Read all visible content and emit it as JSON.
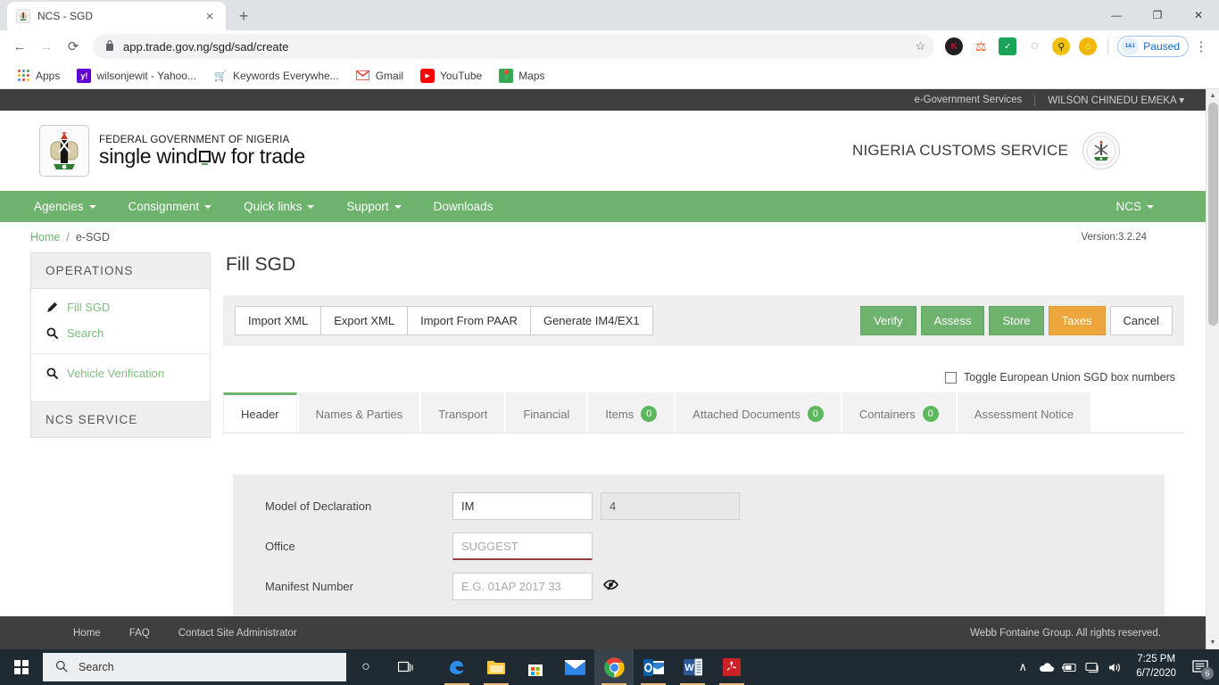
{
  "browser": {
    "tab": {
      "title": "NCS - SGD",
      "favicon": "nigeria-coat-of-arms-icon",
      "close": "×"
    },
    "new_tab_label": "+",
    "window_controls": {
      "minimize": "—",
      "maximize": "❐",
      "close": "✕"
    },
    "nav": {
      "back": "←",
      "forward": "→",
      "reload": "⟳"
    },
    "omnibox": {
      "lock": "🔒",
      "url": "app.trade.gov.ng/sgd/sad/create",
      "star": "☆"
    },
    "extensions": [
      {
        "name": "kaspersky-extension-icon",
        "glyph": "K",
        "color": "#231f20"
      },
      {
        "name": "lighthouse-extension-icon",
        "glyph": "♟",
        "color": "#f4511e"
      },
      {
        "name": "checkmark-extension-icon",
        "glyph": "✔",
        "color": "#18a558"
      },
      {
        "name": "circle-extension-icon",
        "glyph": "◌",
        "color": "#b9bcc0"
      },
      {
        "name": "magnifier-extension-icon",
        "glyph": "🔍",
        "color": "#f2c10e"
      },
      {
        "name": "home-extension-icon",
        "glyph": "⌂",
        "color": "#f2b705"
      }
    ],
    "paused": {
      "label": "Paused",
      "logo_text": "1&1"
    },
    "menu": "⋮",
    "bookmarks": [
      {
        "label": "Apps",
        "icon": "apps-grid-icon"
      },
      {
        "label": "wilsonjewit - Yahoo...",
        "icon": "yahoo-icon",
        "glyph": "y!",
        "color": "#6001d2"
      },
      {
        "label": "Keywords Everywhe...",
        "icon": "keywords-everywhere-icon",
        "glyph": "🛒",
        "color": "#d64545"
      },
      {
        "label": "Gmail",
        "icon": "gmail-icon",
        "glyph": "M",
        "color": "#ea4335"
      },
      {
        "label": "YouTube",
        "icon": "youtube-icon",
        "glyph": "▶",
        "color": "#ff0000"
      },
      {
        "label": "Maps",
        "icon": "google-maps-icon",
        "glyph": "📍",
        "color": "#34a853"
      }
    ]
  },
  "site": {
    "topbar": {
      "egov": "e-Government Services",
      "user": "WILSON CHINEDU EMEKA",
      "caret": "▾"
    },
    "logo": {
      "line1": "FEDERAL GOVERNMENT OF NIGERIA",
      "line2_before": "single wind",
      "line2_after": "w for trade"
    },
    "agency": {
      "title": "NIGERIA CUSTOMS SERVICE"
    },
    "nav": [
      {
        "label": "Agencies",
        "has_caret": true
      },
      {
        "label": "Consignment",
        "has_caret": true
      },
      {
        "label": "Quick links",
        "has_caret": true
      },
      {
        "label": "Support",
        "has_caret": true
      },
      {
        "label": "Downloads",
        "has_caret": false
      }
    ],
    "nav_right": {
      "label": "NCS",
      "has_caret": true
    },
    "breadcrumb": {
      "home": "Home",
      "slash": "/",
      "current": "e-SGD"
    },
    "version": "Version:3.2.24",
    "sidebar": {
      "section1_title": "OPERATIONS",
      "items": [
        {
          "label": "Fill SGD",
          "icon": "pencil-icon",
          "glyph": "✎"
        },
        {
          "label": "Search",
          "icon": "search-icon",
          "glyph": "🔍"
        },
        {
          "label": "Vehicle Verification",
          "icon": "search-icon",
          "glyph": "🔍"
        }
      ],
      "section2_title": "NCS SERVICE"
    },
    "page_title": "Fill SGD",
    "actionbar": {
      "left_buttons": [
        "Import XML",
        "Export XML",
        "Import From PAAR",
        "Generate IM4/EX1"
      ],
      "right_buttons": [
        {
          "label": "Verify",
          "style": "green"
        },
        {
          "label": "Assess",
          "style": "green"
        },
        {
          "label": "Store",
          "style": "green"
        },
        {
          "label": "Taxes",
          "style": "orange"
        },
        {
          "label": "Cancel",
          "style": "white"
        }
      ]
    },
    "toggle_eu": {
      "label": "Toggle European Union SGD box numbers",
      "checked": false
    },
    "tabs": [
      {
        "label": "Header",
        "badge": null,
        "active": true
      },
      {
        "label": "Names & Parties",
        "badge": null,
        "active": false
      },
      {
        "label": "Transport",
        "badge": null,
        "active": false
      },
      {
        "label": "Financial",
        "badge": null,
        "active": false
      },
      {
        "label": "Items",
        "badge": "0",
        "active": false
      },
      {
        "label": "Attached Documents",
        "badge": "0",
        "active": false
      },
      {
        "label": "Containers",
        "badge": "0",
        "active": false
      },
      {
        "label": "Assessment Notice",
        "badge": null,
        "active": false
      }
    ],
    "form": {
      "model_label": "Model of Declaration",
      "model_value": "IM",
      "model_type_value": "4",
      "office_label": "Office",
      "office_placeholder": "SUGGEST",
      "manifest_label": "Manifest Number",
      "manifest_placeholder": "E.G. 01AP 2017 33",
      "manifest_icon": "eye-slash-icon",
      "manifest_icon_glyph": "👁"
    },
    "footer": {
      "links": [
        "Home",
        "FAQ",
        "Contact Site Administrator"
      ],
      "copyright": "Webb Fontaine Group. All rights reserved."
    },
    "scrollbar": {
      "up": "▲",
      "down": "▼"
    }
  },
  "taskbar": {
    "start": "windows-logo-icon",
    "search_placeholder": "Search",
    "search_icon": "magnifier-icon",
    "cortana": "○",
    "taskview": "⌸",
    "apps": [
      {
        "name": "edge-icon",
        "glyph": "e",
        "color": "#0c7cbe"
      },
      {
        "name": "file-explorer-icon",
        "glyph": "🗀",
        "color": "#ffc83d"
      },
      {
        "name": "microsoft-store-icon",
        "glyph": "🛍",
        "color": "#ffffff"
      },
      {
        "name": "mail-icon",
        "glyph": "✉",
        "color": "#0a62c0"
      },
      {
        "name": "chrome-icon",
        "glyph": "◉",
        "color": "#4285f4"
      },
      {
        "name": "outlook-icon",
        "glyph": "O",
        "color": "#0a5fa8"
      },
      {
        "name": "word-icon",
        "glyph": "W",
        "color": "#2b579a"
      },
      {
        "name": "acrobat-reader-icon",
        "glyph": "⬒",
        "color": "#cc2127"
      }
    ],
    "tray": {
      "chevron": "∧",
      "onedrive": "☁",
      "battery": "🔋",
      "network": "🖧",
      "volume": "🔊",
      "time": "7:25 PM",
      "date": "6/7/2020",
      "notification_count": "6"
    }
  }
}
